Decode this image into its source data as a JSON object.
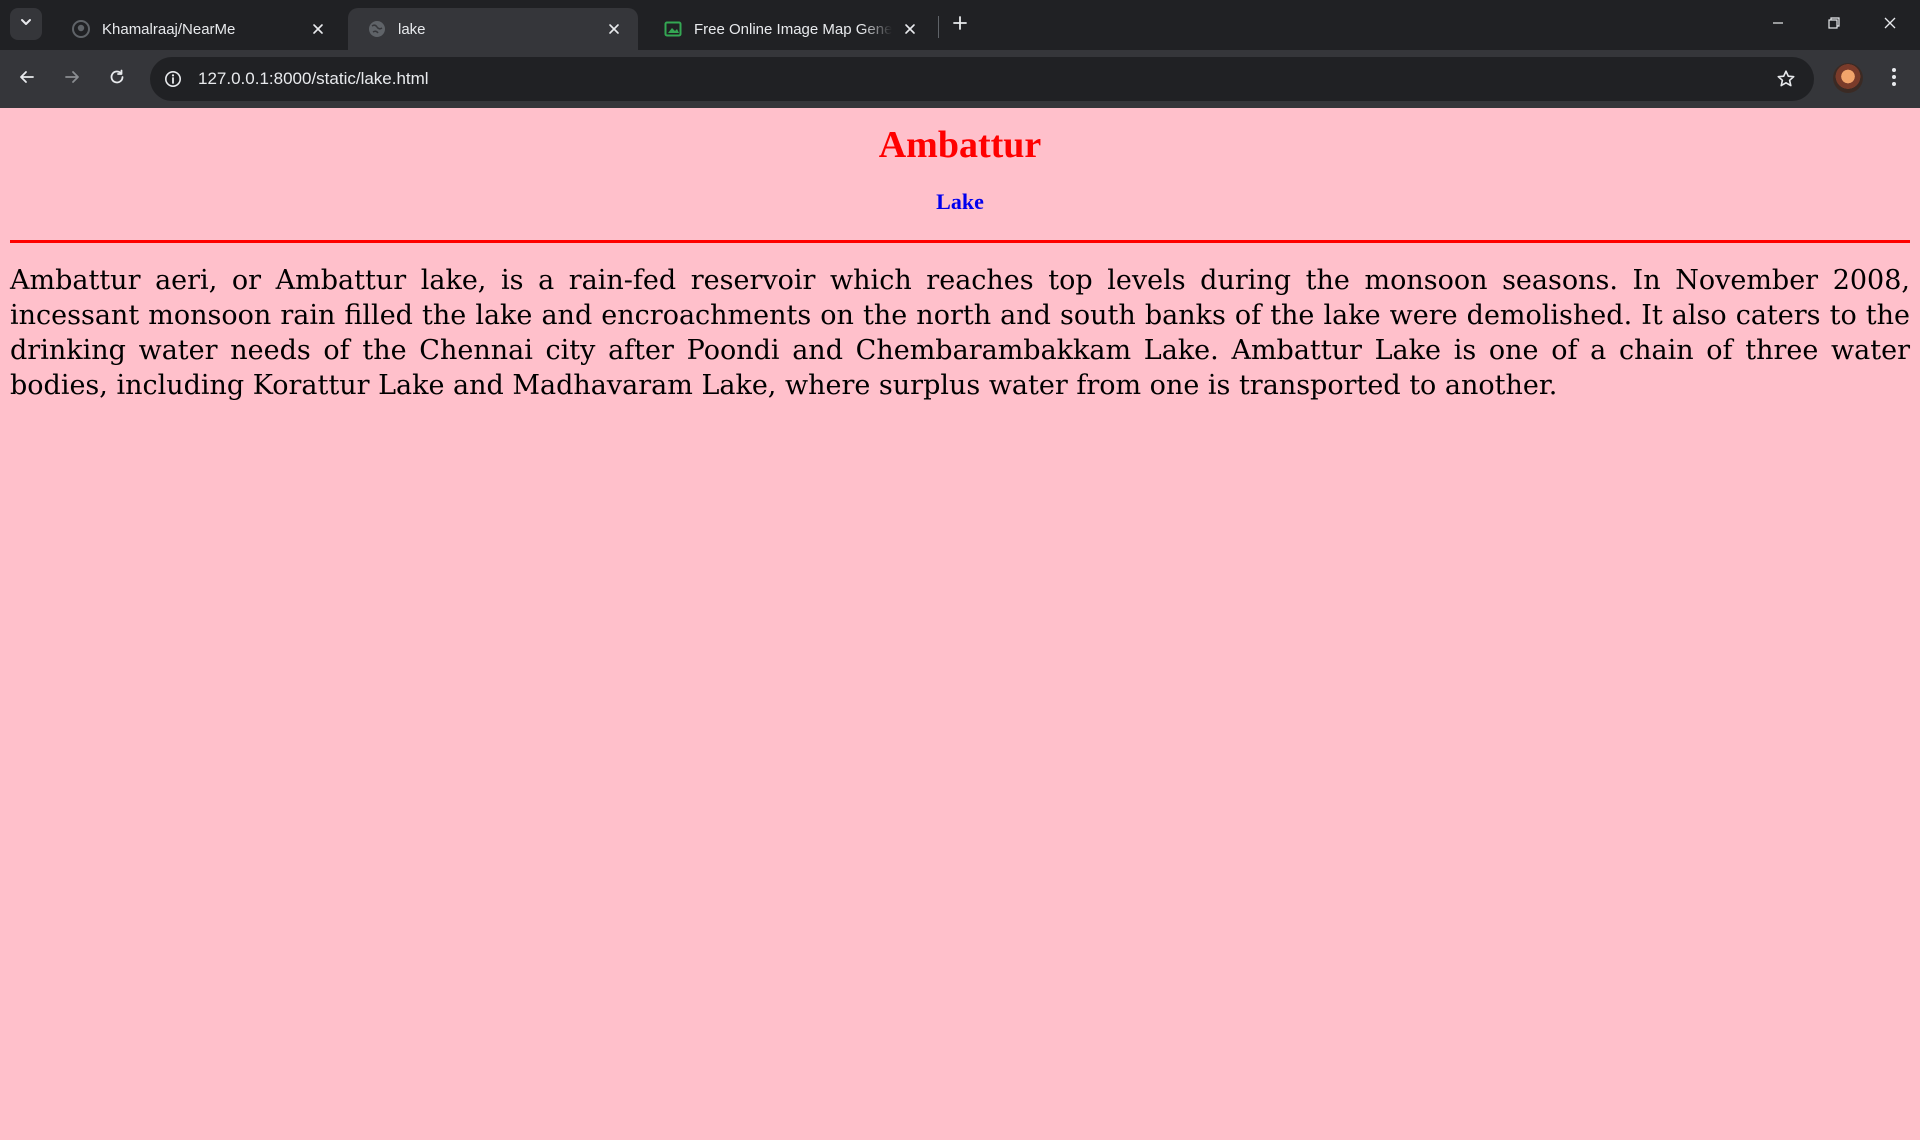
{
  "browser": {
    "tabs": [
      {
        "title": "Khamalraaj/NearMe",
        "icon": "github-icon"
      },
      {
        "title": "lake",
        "icon": "globe-icon"
      },
      {
        "title": "Free Online Image Map Generator",
        "icon": "image-icon"
      }
    ],
    "active_tab_index": 1,
    "address_bar": {
      "url": "127.0.0.1:8000/static/lake.html"
    }
  },
  "page": {
    "title": "Ambattur",
    "subtitle": "Lake",
    "body": "Ambattur aeri, or Ambattur lake, is a rain-fed reservoir which reaches top levels during the monsoon seasons. In November 2008, incessant monsoon rain filled the lake and encroachments on the north and south banks of the lake were demolished. It also caters to the drinking water needs of the Chennai city after Poondi and Chembarambakkam Lake. Ambattur Lake is one of a chain of three water bodies, including Korattur Lake and Madhavaram Lake, where surplus water from one is transported to another.",
    "colors": {
      "background": "#ffc0cb",
      "title": "#ff0000",
      "subtitle": "#0000ee",
      "divider": "#ff0000"
    }
  }
}
